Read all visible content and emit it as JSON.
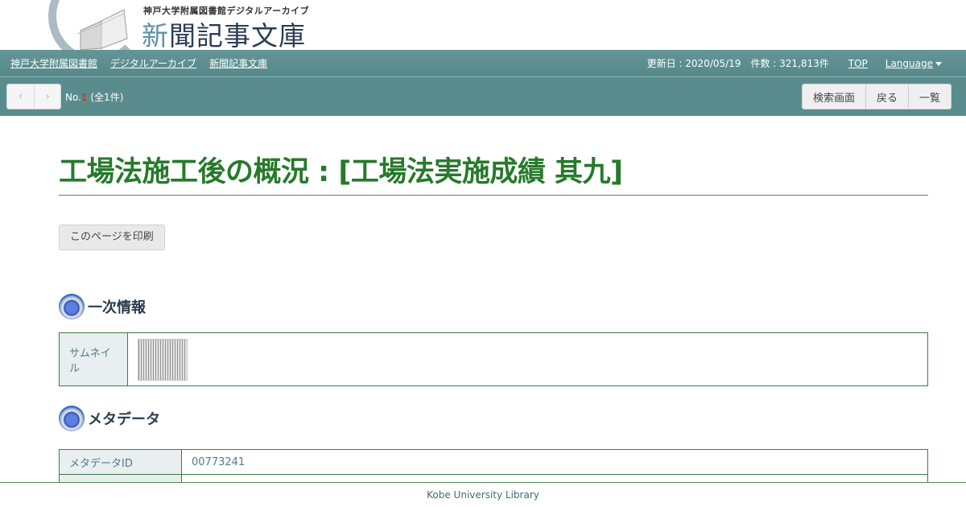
{
  "header": {
    "logo_sub": "神戸大学附属図書館デジタルアーカイブ",
    "logo_main_first": "新",
    "logo_main_rest": "聞記事文庫"
  },
  "nav": {
    "links": [
      "神戸大学附属図書館",
      "デジタルアーカイブ",
      "新聞記事文庫"
    ],
    "updated": "更新日 : 2020/05/19",
    "count": "件数 : 321,813件",
    "top": "TOP",
    "language": "Language"
  },
  "toolbar": {
    "prev": "‹",
    "next": "›",
    "no_prefix": "No.",
    "no_value": "1",
    "total": " (全1件)",
    "buttons": [
      "検索画面",
      "戻る",
      "一覧"
    ]
  },
  "main": {
    "title": "工場法施工後の概況 : [工場法実施成績 其九]",
    "print_button": "このページを印刷",
    "section1": "一次情報",
    "thumbnail_label": "サムネイル",
    "section2": "メタデータ",
    "metadata_rows": [
      {
        "label": "メタデータID",
        "value": "00773241"
      },
      {
        "label": "",
        "value": ""
      }
    ]
  },
  "footer": {
    "text": "Kobe University Library"
  },
  "colors": {
    "navbar": "#5a8c8e",
    "title": "#267a2a",
    "border": "#3f7a45"
  }
}
